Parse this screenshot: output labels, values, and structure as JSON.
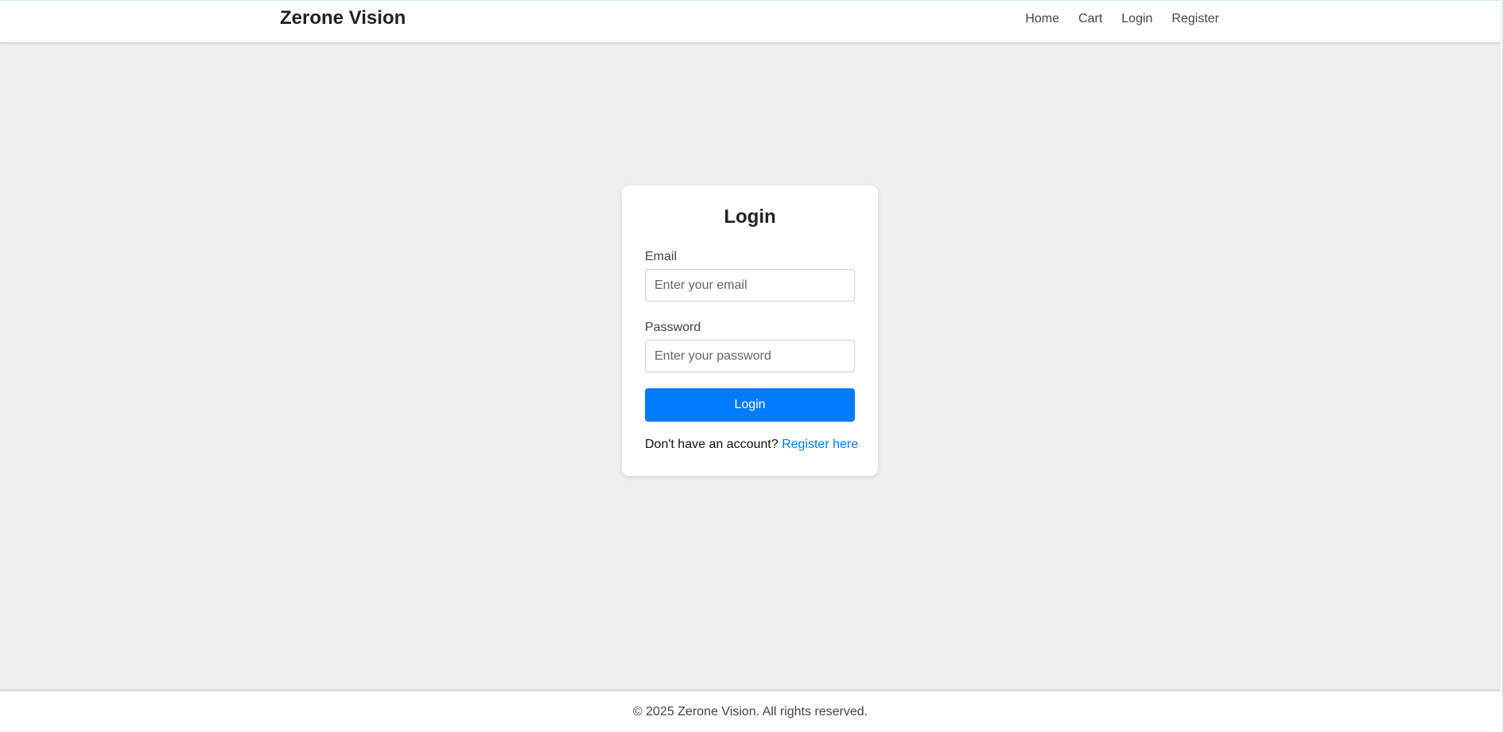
{
  "header": {
    "brand": "Zerone Vision",
    "nav": [
      {
        "label": "Home"
      },
      {
        "label": "Cart"
      },
      {
        "label": "Login"
      },
      {
        "label": "Register"
      }
    ]
  },
  "login_form": {
    "title": "Login",
    "email": {
      "label": "Email",
      "value": "",
      "placeholder": "Enter your email"
    },
    "password": {
      "label": "Password",
      "value": "",
      "placeholder": "Enter your password"
    },
    "submit_label": "Login",
    "register_prompt": "Don't have an account?",
    "register_link": "Register here"
  },
  "footer": {
    "text": "© 2025 Zerone Vision. All rights reserved."
  },
  "colors": {
    "background": "#efefef",
    "primary": "#007bff",
    "text": "#222222",
    "muted_text": "#444444"
  }
}
